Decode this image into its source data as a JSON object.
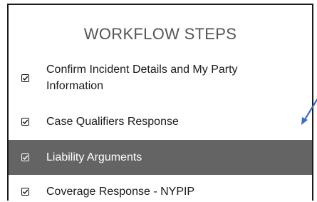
{
  "panel": {
    "title": "WORKFLOW STEPS"
  },
  "steps": [
    {
      "label": "Confirm Incident Details and My Party Information",
      "checked": true,
      "active": false
    },
    {
      "label": "Case Qualifiers Response",
      "checked": true,
      "active": false
    },
    {
      "label": "Liability Arguments",
      "checked": true,
      "active": true
    },
    {
      "label": "Coverage Response - NYPIP",
      "checked": true,
      "active": false
    }
  ],
  "colors": {
    "active_row_bg": "#646464",
    "arrow": "#3a6fc4"
  },
  "icons": {
    "checkbox": "checkbox-checked-icon",
    "arrow": "pointer-arrow-icon"
  }
}
